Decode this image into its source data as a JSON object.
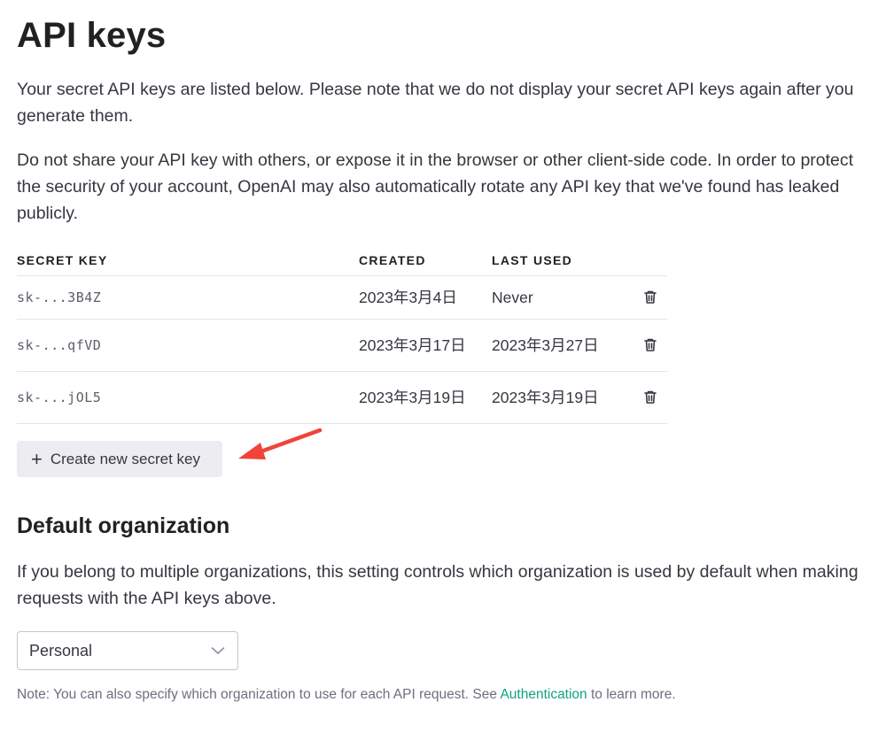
{
  "page": {
    "title": "API keys",
    "intro_1": "Your secret API keys are listed below. Please note that we do not display your secret API keys again after you generate them.",
    "intro_2": "Do not share your API key with others, or expose it in the browser or other client-side code. In order to protect the security of your account, OpenAI may also automatically rotate any API key that we've found has leaked publicly."
  },
  "keys_table": {
    "columns": [
      "SECRET KEY",
      "CREATED",
      "LAST USED"
    ],
    "rows": [
      {
        "key": "sk-...3B4Z",
        "created": "2023年3月4日",
        "last_used": "Never"
      },
      {
        "key": "sk-...qfVD",
        "created": "2023年3月17日",
        "last_used": "2023年3月27日"
      },
      {
        "key": "sk-...jOL5",
        "created": "2023年3月19日",
        "last_used": "2023年3月19日"
      }
    ],
    "delete_icon": "trash-icon"
  },
  "create_button": {
    "icon": "+",
    "label": "Create new secret key"
  },
  "default_org": {
    "title": "Default organization",
    "description": "If you belong to multiple organizations, this setting controls which organization is used by default when making requests with the API keys above.",
    "selected": "Personal",
    "note_prefix": "Note: You can also specify which organization to use for each API request. See ",
    "note_link": "Authentication",
    "note_suffix": " to learn more."
  },
  "colors": {
    "accent_link": "#10a37f",
    "button_bg": "#ececf1",
    "annotation_arrow": "#f04438"
  }
}
